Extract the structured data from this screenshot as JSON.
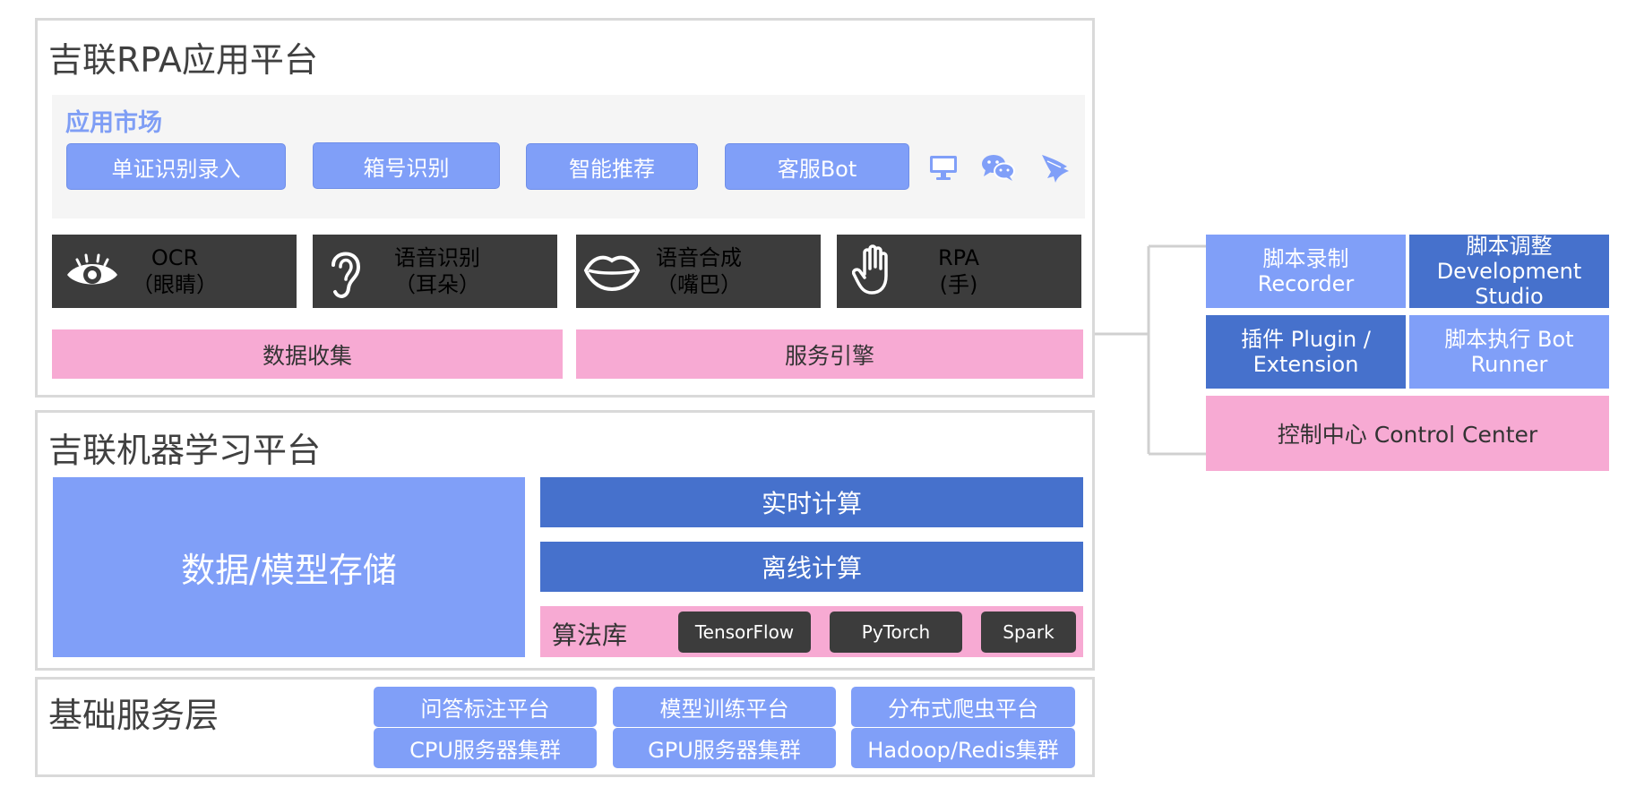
{
  "rpa_platform": {
    "title": "吉联RPA应用平台",
    "market": {
      "title": "应用市场",
      "apps": [
        "单证识别录入",
        "箱号识别",
        "智能推荐",
        "客服Bot"
      ],
      "icons": [
        "monitor-icon",
        "wechat-icon",
        "bird-icon"
      ]
    },
    "capabilities": [
      {
        "line1": "OCR",
        "line2": "（眼睛）",
        "icon": "eye-icon"
      },
      {
        "line1": "语音识别",
        "line2": "（耳朵）",
        "icon": "ear-icon"
      },
      {
        "line1": "语音合成",
        "line2": "（嘴巴）",
        "icon": "lips-icon"
      },
      {
        "line1": "RPA",
        "line2": "(手)",
        "icon": "hand-icon"
      }
    ],
    "data_collection": "数据收集",
    "service_engine": "服务引擎"
  },
  "ml_platform": {
    "title": "吉联机器学习平台",
    "storage": "数据/模型存储",
    "realtime": "实时计算",
    "offline": "离线计算",
    "algo_label": "算法库",
    "algos": [
      "TensorFlow",
      "PyTorch",
      "Spark"
    ]
  },
  "base_layer": {
    "title": "基础服务层",
    "row1": [
      "问答标注平台",
      "模型训练平台",
      "分布式爬虫平台"
    ],
    "row2": [
      "CPU服务器集群",
      "GPU服务器集群",
      "Hadoop/Redis集群"
    ]
  },
  "rpa_components": {
    "recorder": [
      "脚本录制",
      "Recorder"
    ],
    "studio": [
      "脚本调整",
      "Development",
      "Studio"
    ],
    "plugin": [
      "插件 Plugin /",
      "Extension"
    ],
    "runner": [
      "脚本执行 Bot",
      "Runner"
    ],
    "control_center": "控制中心 Control Center"
  },
  "colors": {
    "light_blue": "#809ff8",
    "dark_blue": "#4671cc",
    "pink": "#f7aad3",
    "dark_gray": "#3c3c3c",
    "border_gray": "#d9d9d9"
  }
}
